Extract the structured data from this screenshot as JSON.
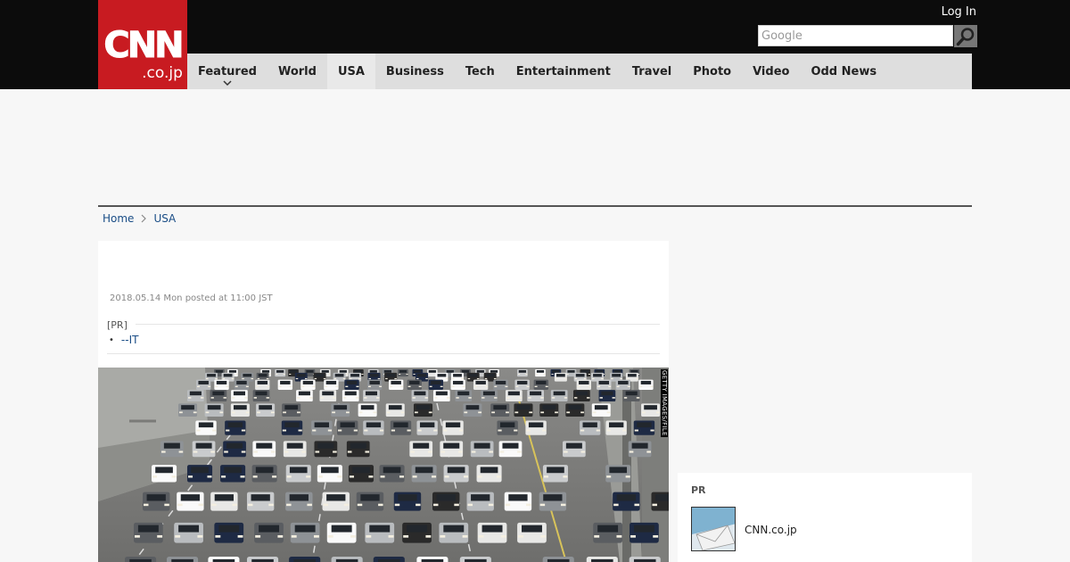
{
  "header": {
    "logo_text": "CNN",
    "logo_sub": ".co.jp",
    "login_label": "Log In",
    "search": {
      "placeholder": "Google",
      "value": ""
    },
    "colors": {
      "bar": "#0c0c0c",
      "logo_bg": "#c81b21",
      "nav_bg": "#dedede"
    }
  },
  "nav": {
    "items": [
      {
        "label": "Featured",
        "has_dropdown": true
      },
      {
        "label": "World"
      },
      {
        "label": "USA",
        "active": true
      },
      {
        "label": "Business"
      },
      {
        "label": "Tech"
      },
      {
        "label": "Entertainment"
      },
      {
        "label": "Travel"
      },
      {
        "label": "Photo"
      },
      {
        "label": "Video"
      },
      {
        "label": "Odd News"
      }
    ]
  },
  "breadcrumb": {
    "home": "Home",
    "section": "USA"
  },
  "article": {
    "posted": "2018.05.14 Mon posted at 11:00 JST",
    "pr_label": "[PR]",
    "pr_link": "--IT",
    "photo_credit": "GETTY IMAGES/FILE",
    "photo_subject": "freeway traffic"
  },
  "sidebar": {
    "pr_title": "PR",
    "pr_item": "CNN.co.jp"
  }
}
